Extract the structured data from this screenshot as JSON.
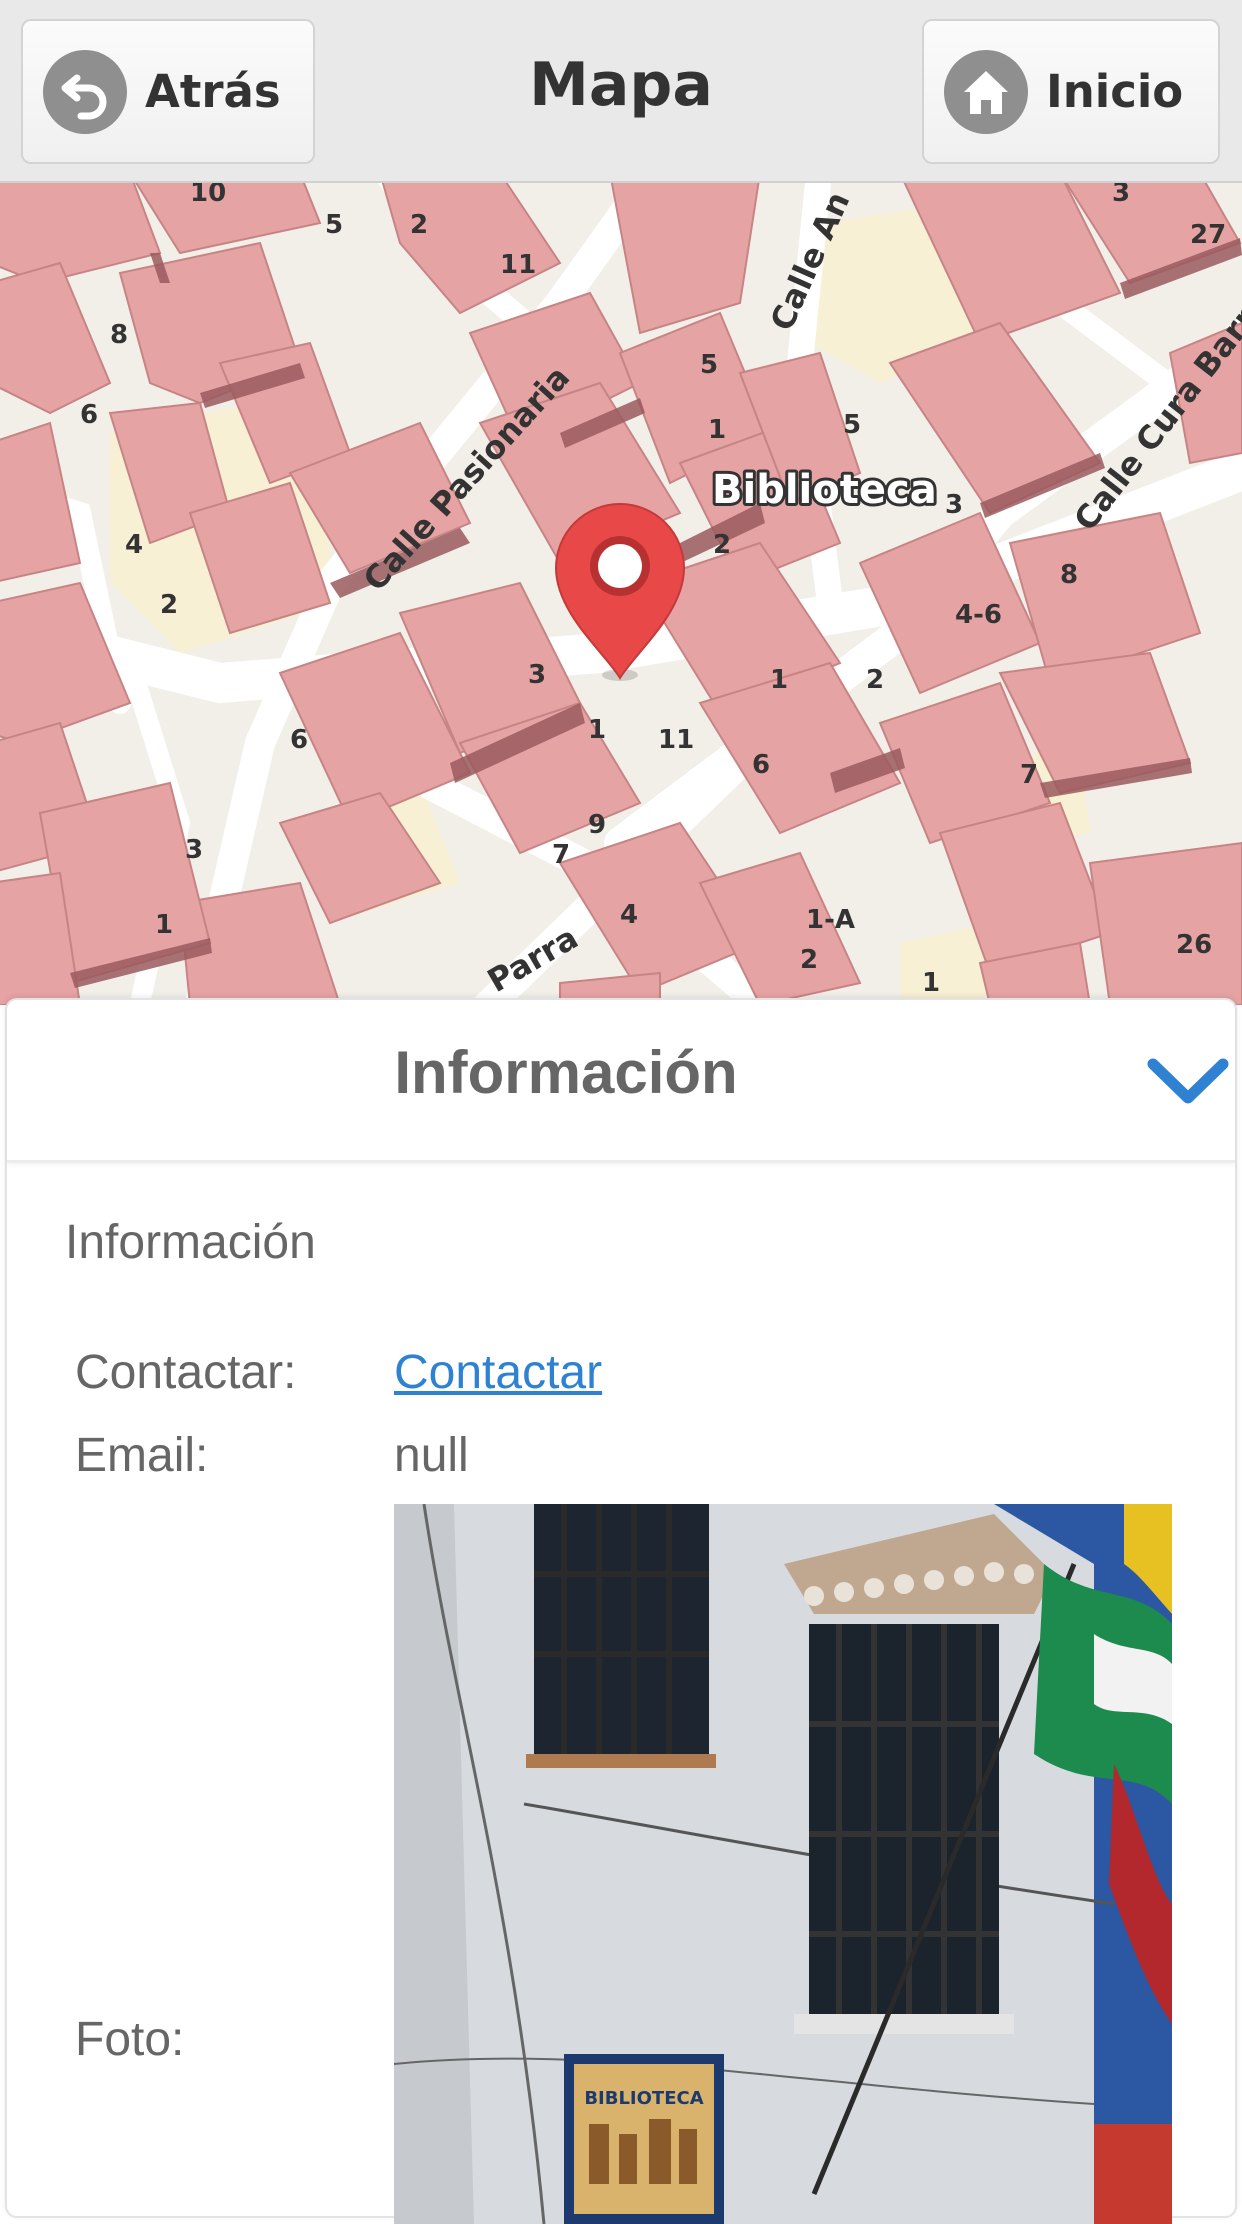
{
  "header": {
    "back_label": "Atrás",
    "title": "Mapa",
    "home_label": "Inicio",
    "back_icon": "undo-arrow-icon",
    "home_icon": "home-icon"
  },
  "map": {
    "poi_label": "Biblioteca",
    "marker_color": "#e84848",
    "building_color": "#e6a3a3",
    "streets": [
      "Calle Pasionaria",
      "Calle An",
      "Calle Cura Barr",
      "Parra"
    ],
    "house_numbers": [
      "10",
      "5",
      "2",
      "11",
      "8",
      "6",
      "4",
      "2",
      "5",
      "1",
      "5",
      "3",
      "2",
      "27",
      "3",
      "1",
      "1",
      "3",
      "11",
      "6",
      "9",
      "7",
      "4",
      "8",
      "4-6",
      "2",
      "6",
      "7",
      "1-A",
      "2",
      "1",
      "26",
      "3",
      "1"
    ]
  },
  "info": {
    "header_title": "Información",
    "section_title": "Información",
    "contact_label": "Contactar:",
    "contact_link": "Contactar",
    "email_label": "Email:",
    "email_value": "null",
    "photo_label": "Foto:",
    "photo_sign_text": "BIBLIOTECA",
    "accent_color": "#2f82d2"
  }
}
